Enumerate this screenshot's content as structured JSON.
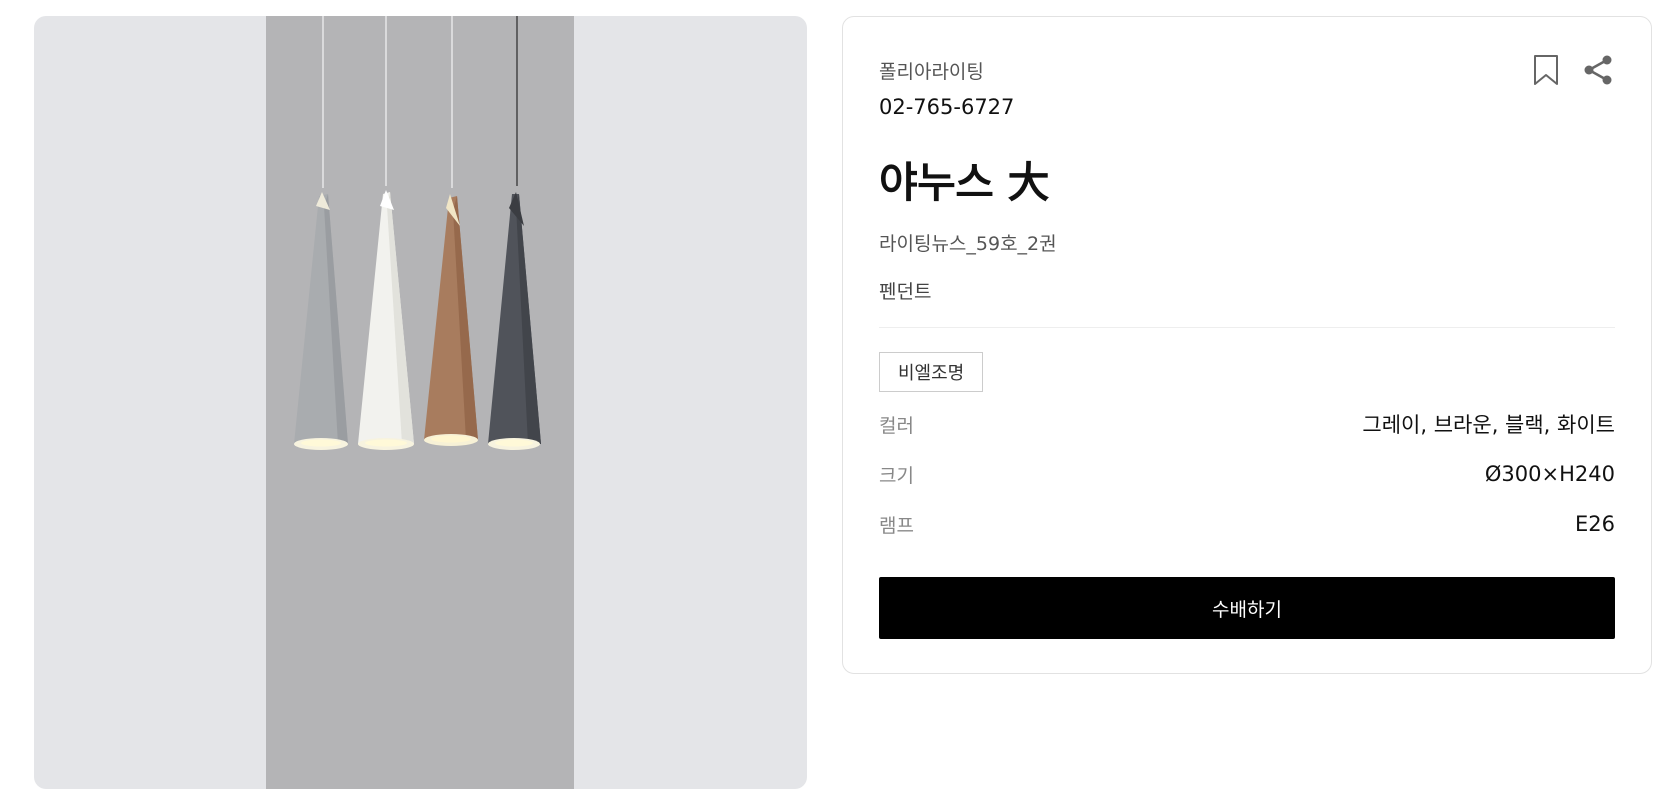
{
  "product": {
    "brand": "폴리아라이팅",
    "phone": "02-765-6727",
    "name": "야누스 大",
    "source": "라이팅뉴스_59호_2권",
    "category": "펜던트",
    "tag": "비엘조명",
    "specs": [
      {
        "key": "컬러",
        "value": "그레이, 브라운, 블랙, 화이트"
      },
      {
        "key": "크기",
        "value": "Ø300×H240"
      },
      {
        "key": "램프",
        "value": "E26"
      }
    ],
    "order_label": "수배하기"
  },
  "icons": {
    "bookmark": "bookmark-icon",
    "share": "share-icon"
  },
  "colors": {
    "gallery_bg": "#e4e5e8",
    "photo_bg": "#b4b4b6",
    "button_bg": "#000000",
    "lamp_gray": "#a9acaf",
    "lamp_white": "#f2f2ee",
    "lamp_brown": "#a87c5e",
    "lamp_black": "#50535a"
  }
}
